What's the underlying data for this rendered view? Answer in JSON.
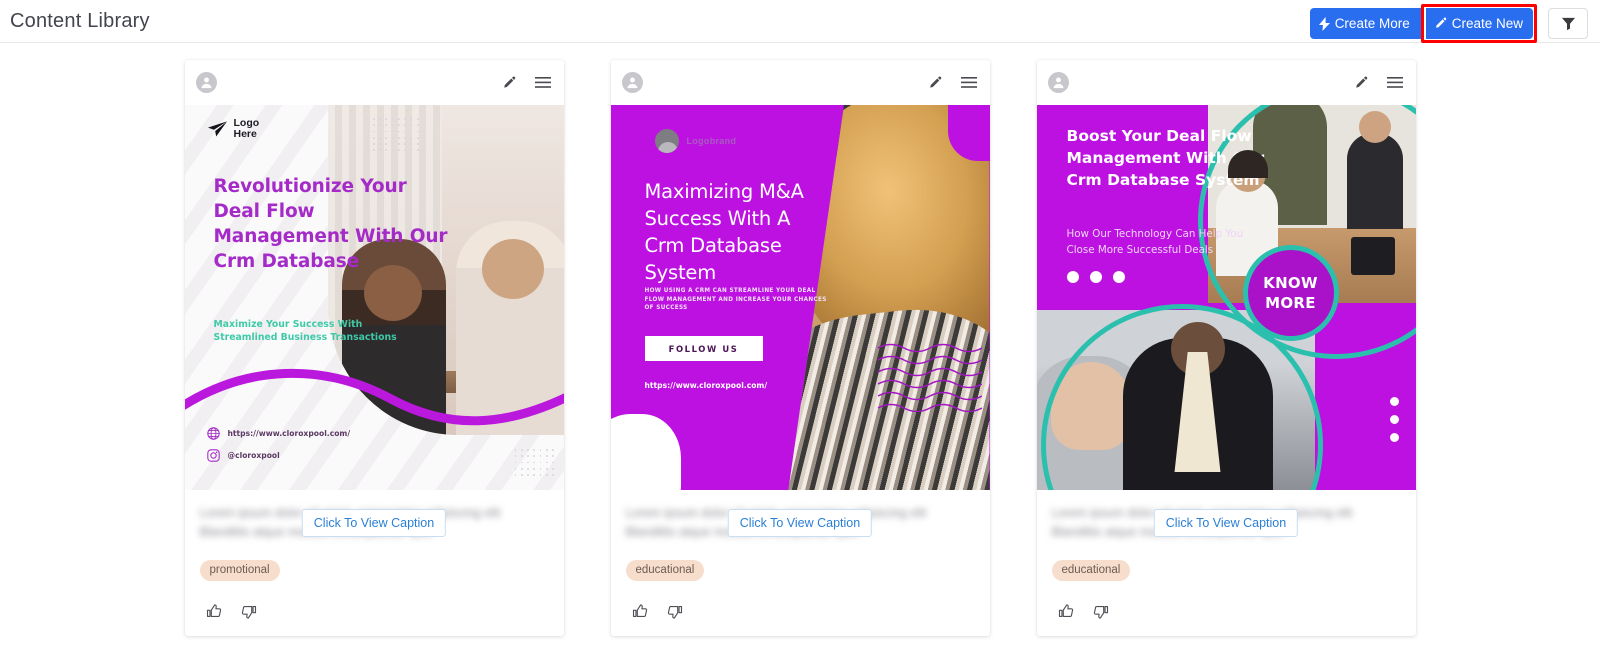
{
  "header": {
    "title": "Content Library",
    "actions": {
      "create_more_label": "Create More",
      "create_more_icon": "lightning-bolt-icon",
      "create_new_label": "Create New",
      "create_new_icon": "pencil-icon",
      "filter_icon": "funnel-filter-icon",
      "highlight_color": "#ff0000",
      "button_color": "#2a6ef0"
    }
  },
  "cards": [
    {
      "avatar_icon": "user-avatar-icon",
      "edit_icon": "pencil-icon",
      "menu_icon": "hamburger-menu-icon",
      "poster": {
        "variant": "light",
        "logo_text": "Logo\nHere",
        "logo_icon": "paper-plane-icon",
        "headline": "Revolutionize Your\nDeal Flow\nManagement With Our\nCrm Database",
        "subline": "Maximize Your Success With\nStreamlined Business Transactions",
        "website_icon": "globe-icon",
        "website": "https://www.cloroxpool.com/",
        "instagram_icon": "instagram-icon",
        "instagram": "@cloroxpool",
        "accent_color": "#a42bc8",
        "subline_color": "#3ecaa8"
      },
      "caption_blurred": "Lorem ipsum dolor sit amet, consectetur adipiscing elit\nBlanditiis atque mollitia consequuntur quis",
      "caption_button": "Click To View Caption",
      "tag": "promotional",
      "like_icon": "thumbs-up-icon",
      "dislike_icon": "thumbs-down-icon"
    },
    {
      "avatar_icon": "user-avatar-icon",
      "edit_icon": "pencil-icon",
      "menu_icon": "hamburger-menu-icon",
      "poster": {
        "variant": "magenta",
        "logo_text": "Logobrand",
        "logo_icon": "brand-circle-icon",
        "headline": "Maximizing M&A\nSuccess With A\nCrm Database\nSystem",
        "fine_print": "HOW USING A CRM CAN STREAMLINE YOUR DEAL FLOW MANAGEMENT AND INCREASE YOUR CHANCES OF SUCCESS",
        "cta_label": "FOLLOW US",
        "website": "https://www.cloroxpool.com/",
        "accent_color": "#bd11e2"
      },
      "caption_blurred": "Lorem ipsum dolor sit amet, consectetur adipiscing elit\nBlanditiis atque mollitia consequuntur quis",
      "caption_button": "Click To View Caption",
      "tag": "educational",
      "like_icon": "thumbs-up-icon",
      "dislike_icon": "thumbs-down-icon"
    },
    {
      "avatar_icon": "user-avatar-icon",
      "edit_icon": "pencil-icon",
      "menu_icon": "hamburger-menu-icon",
      "poster": {
        "variant": "magenta-teal",
        "headline": "Boost Your Deal Flow\nManagement With Our\nCrm Database System",
        "subline": "How Our Technology Can Help You\nClose More Successful Deals",
        "badge_label": "KNOW\nMORE",
        "accent_color": "#bd11e2",
        "ring_color": "#2bbfae"
      },
      "caption_blurred": "Lorem ipsum dolor sit amet, consectetur adipiscing elit\nBlanditiis atque mollitia consequuntur quis",
      "caption_button": "Click To View Caption",
      "tag": "educational",
      "like_icon": "thumbs-up-icon",
      "dislike_icon": "thumbs-down-icon"
    }
  ]
}
